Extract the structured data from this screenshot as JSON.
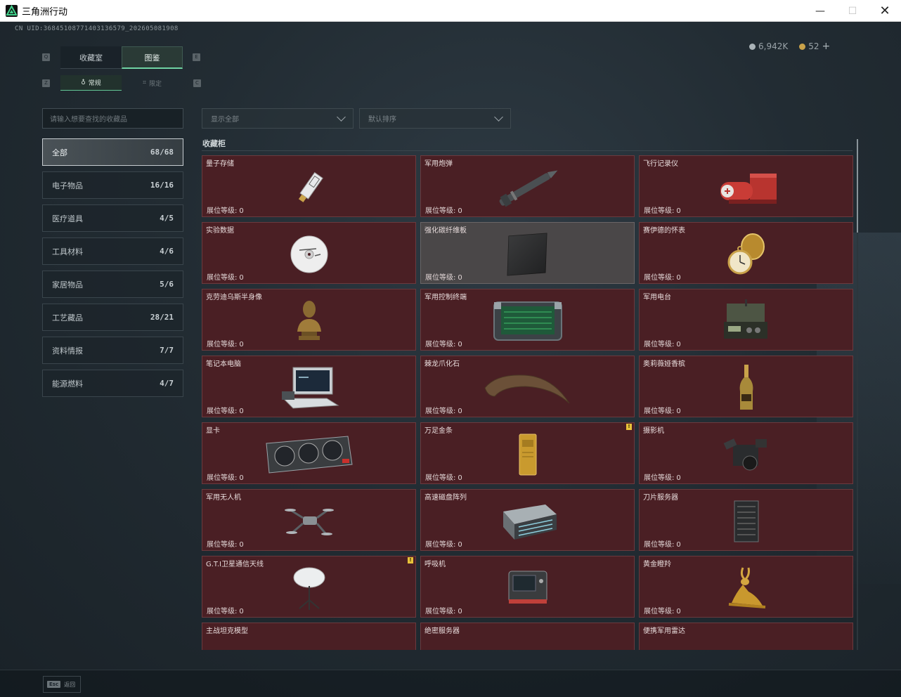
{
  "window": {
    "title": "三角洲行动",
    "minimize_glyph": "—",
    "maximize_glyph": "☐",
    "close_glyph": "✕"
  },
  "uid": "CN UID:36845108771403136579_202605081908",
  "currency": [
    {
      "icon": "silver-coin-icon",
      "value": "6,942K"
    },
    {
      "icon": "gold-coin-icon",
      "value": "52"
    }
  ],
  "currency_add": "+",
  "tabs_main": [
    {
      "label": "收藏室"
    },
    {
      "label": "图鉴"
    }
  ],
  "tabs_sub": [
    {
      "label": "常规",
      "icon": "♁"
    },
    {
      "label": "限定",
      "icon": "⌗"
    }
  ],
  "key_hints": {
    "q": "Q",
    "e": "E",
    "z": "Z",
    "c": "C"
  },
  "search": {
    "placeholder": "请输入想要查找的收藏品"
  },
  "filters": {
    "display": "显示全部",
    "sort": "默认排序"
  },
  "categories": [
    {
      "label": "全部",
      "count": "68/68"
    },
    {
      "label": "电子物品",
      "count": "16/16"
    },
    {
      "label": "医疗道具",
      "count": "4/5"
    },
    {
      "label": "工具材料",
      "count": "4/6"
    },
    {
      "label": "家居物品",
      "count": "5/6"
    },
    {
      "label": "工艺藏品",
      "count": "28/21"
    },
    {
      "label": "资料情报",
      "count": "7/7"
    },
    {
      "label": "能源燃料",
      "count": "4/7"
    }
  ],
  "section_title": "收藏柜",
  "level_label": "展位等级:",
  "items": [
    {
      "name": "量子存储",
      "level": "0"
    },
    {
      "name": "军用炮弹",
      "level": "0"
    },
    {
      "name": "飞行记录仪",
      "level": "0"
    },
    {
      "name": "实验数据",
      "level": "0"
    },
    {
      "name": "强化碳纤维板",
      "level": "0"
    },
    {
      "name": "赛伊德的怀表",
      "level": "0"
    },
    {
      "name": "克劳迪乌斯半身像",
      "level": "0"
    },
    {
      "name": "军用控制终端",
      "level": "0"
    },
    {
      "name": "军用电台",
      "level": "0"
    },
    {
      "name": "笔记本电脑",
      "level": "0"
    },
    {
      "name": "棘龙爪化石",
      "level": "0"
    },
    {
      "name": "奥莉薇娅香槟",
      "level": "0"
    },
    {
      "name": "显卡",
      "level": "0"
    },
    {
      "name": "万足金条",
      "level": "0",
      "badge": "!"
    },
    {
      "name": "摄影机",
      "level": "0"
    },
    {
      "name": "军用无人机",
      "level": "0"
    },
    {
      "name": "高速磁盘阵列",
      "level": "0"
    },
    {
      "name": "刀片服务器",
      "level": "0"
    },
    {
      "name": "G.T.I卫星通信天线",
      "level": "0",
      "badge": "!"
    },
    {
      "name": "呼吸机",
      "level": "0"
    },
    {
      "name": "黄金瞪羚",
      "level": "0"
    },
    {
      "name": "主战坦克模型",
      "level": ""
    },
    {
      "name": "绝密服务器",
      "level": ""
    },
    {
      "name": "便携军用雷达",
      "level": ""
    }
  ],
  "footer": {
    "esc_key": "Esc",
    "esc_label": "返回"
  }
}
